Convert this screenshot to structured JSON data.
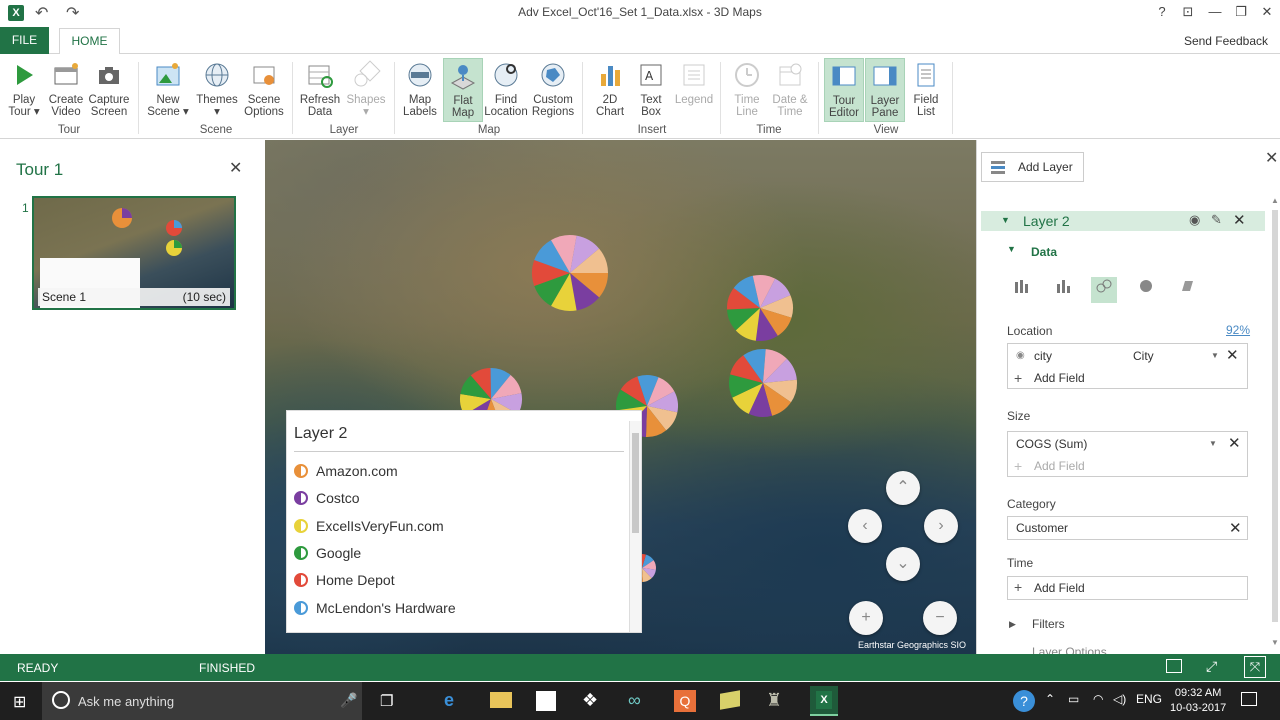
{
  "app": {
    "title": "Adv Excel_Oct'16_Set 1_Data.xlsx - 3D Maps",
    "icon": "excel-icon"
  },
  "title_bar": {
    "help_label": "?",
    "restore_ribbon_label": "⊡",
    "minimize_label": "—",
    "maximize_label": "❐",
    "close_label": "✕"
  },
  "ribbon_tabs": {
    "file": "FILE",
    "home": "HOME",
    "send_feedback": "Send Feedback"
  },
  "ribbon": {
    "groups": {
      "tour": "Tour",
      "scene": "Scene",
      "layer": "Layer",
      "map": "Map",
      "insert": "Insert",
      "time": "Time",
      "view": "View"
    },
    "buttons": {
      "play_tour": "Play\nTour ▾",
      "create_video": "Create\nVideo",
      "capture_screen": "Capture\nScreen",
      "new_scene": "New\nScene ▾",
      "themes": "Themes\n▾",
      "scene_options": "Scene\nOptions",
      "refresh_data": "Refresh\nData",
      "shapes": "Shapes\n▾",
      "map_labels": "Map\nLabels",
      "flat_map": "Flat\nMap",
      "find_location": "Find\nLocation",
      "custom_regions": "Custom\nRegions",
      "chart_2d": "2D\nChart",
      "text_box": "Text\nBox",
      "legend": "Legend",
      "time_line": "Time\nLine",
      "date_time": "Date &\nTime",
      "tour_editor": "Tour\nEditor",
      "layer_pane": "Layer\nPane",
      "field_list": "Field\nList"
    }
  },
  "tour_panel": {
    "title": "Tour 1",
    "close_label": "✕",
    "scenes": [
      {
        "number": "1",
        "name": "Scene 1",
        "duration": "(10 sec)"
      }
    ]
  },
  "map": {
    "attribution": "Earthstar Geographics  SIO",
    "nav": {
      "up": "⌃",
      "left": "‹",
      "right": "›",
      "down": "⌄",
      "zoom_in": "+",
      "zoom_out": "−"
    }
  },
  "legend": {
    "title": "Layer 2",
    "items": [
      {
        "label": "Amazon.com",
        "color": "#e8903a"
      },
      {
        "label": "Costco",
        "color": "#7a3ea0"
      },
      {
        "label": "ExcelIsVeryFun.com",
        "color": "#e8d23a"
      },
      {
        "label": "Google",
        "color": "#2e9a3e"
      },
      {
        "label": "Home Depot",
        "color": "#e24a3a"
      },
      {
        "label": "McLendon's Hardware",
        "color": "#4a9ad8"
      }
    ]
  },
  "layer_pane": {
    "add_layer": "Add Layer",
    "close_label": "✕",
    "layer_name": "Layer 2",
    "data_section": "Data",
    "location_label": "Location",
    "location_confidence": "92%",
    "location_field": "city",
    "location_type": "City",
    "add_field": "Add Field",
    "size_label": "Size",
    "size_field": "COGS (Sum)",
    "category_label": "Category",
    "category_field": "Customer",
    "time_label": "Time",
    "filters": "Filters",
    "layer_options": "Layer Options"
  },
  "status_bar": {
    "ready": "READY",
    "finished": "FINISHED"
  },
  "taskbar": {
    "search_placeholder": "Ask me anything",
    "language": "ENG",
    "time": "09:32 AM",
    "date": "10-03-2017"
  },
  "colors": {
    "excel_green": "#217346",
    "selected_green": "#c5e3cf"
  }
}
